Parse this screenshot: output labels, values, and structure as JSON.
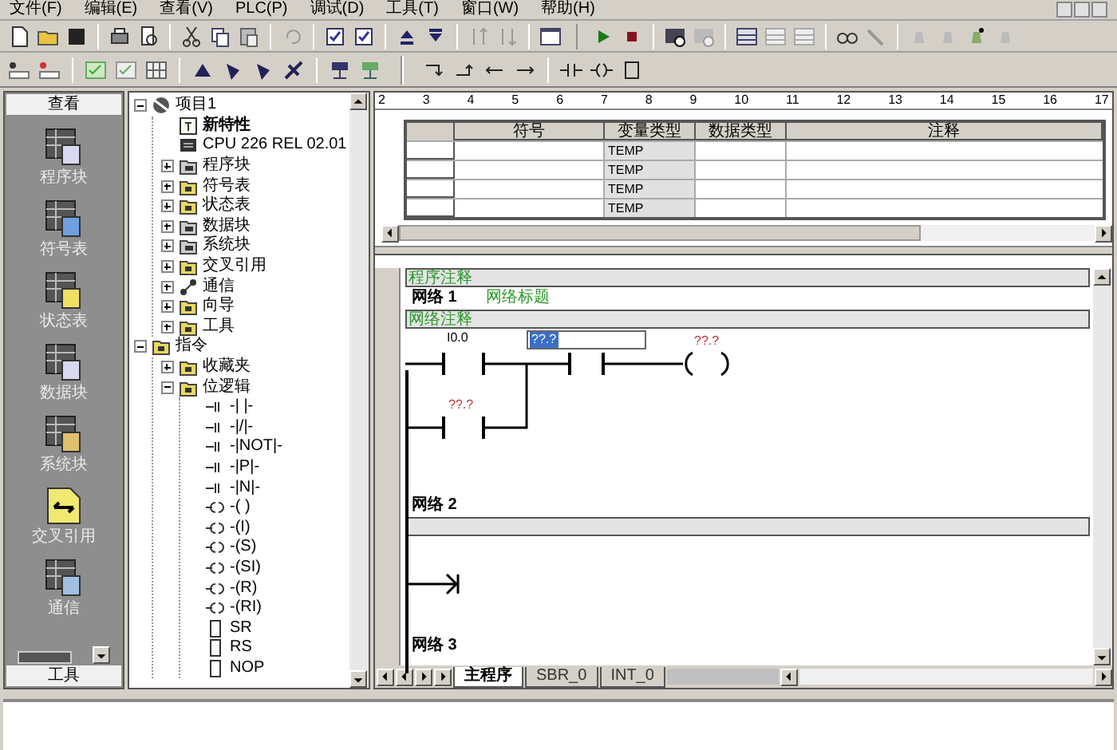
{
  "menu": [
    {
      "label": "文件(F)"
    },
    {
      "label": "编辑(E)"
    },
    {
      "label": "查看(V)"
    },
    {
      "label": "PLC(P)"
    },
    {
      "label": "调试(D)"
    },
    {
      "label": "工具(T)"
    },
    {
      "label": "窗口(W)"
    },
    {
      "label": "帮助(H)"
    }
  ],
  "nav_bar": {
    "header": "查看",
    "items": [
      {
        "label": "程序块"
      },
      {
        "label": "符号表"
      },
      {
        "label": "状态表"
      },
      {
        "label": "数据块"
      },
      {
        "label": "系统块"
      },
      {
        "label": "交叉引用"
      },
      {
        "label": "通信"
      }
    ],
    "footer": "工具"
  },
  "tree": [
    {
      "label": "项目1",
      "kind": "project",
      "expanded": true,
      "children": [
        {
          "label": "新特性",
          "kind": "notes"
        },
        {
          "label": "CPU 226 REL 02.01",
          "kind": "cpu"
        },
        {
          "label": "程序块",
          "kind": "block",
          "expanded": false
        },
        {
          "label": "符号表",
          "kind": "folder",
          "expanded": false
        },
        {
          "label": "状态表",
          "kind": "folder",
          "expanded": false
        },
        {
          "label": "数据块",
          "kind": "block",
          "expanded": false
        },
        {
          "label": "系统块",
          "kind": "block",
          "expanded": false
        },
        {
          "label": "交叉引用",
          "kind": "folder",
          "expanded": false
        },
        {
          "label": "通信",
          "kind": "comms",
          "expanded": false
        },
        {
          "label": "向导",
          "kind": "folder",
          "expanded": false
        },
        {
          "label": "工具",
          "kind": "folder",
          "expanded": false
        }
      ]
    },
    {
      "label": "指令",
      "kind": "folder",
      "expanded": true,
      "children": [
        {
          "label": "收藏夹",
          "kind": "folder",
          "expanded": false
        },
        {
          "label": "位逻辑",
          "kind": "folder",
          "expanded": true,
          "children": [
            {
              "label": "-| |-",
              "kind": "contact"
            },
            {
              "label": "-|/|-",
              "kind": "contact"
            },
            {
              "label": "-|NOT|-",
              "kind": "contact"
            },
            {
              "label": "-|P|-",
              "kind": "contact"
            },
            {
              "label": "-|N|-",
              "kind": "contact"
            },
            {
              "label": "-( )",
              "kind": "coil"
            },
            {
              "label": "-(I)",
              "kind": "coil"
            },
            {
              "label": "-(S)",
              "kind": "coil"
            },
            {
              "label": "-(SI)",
              "kind": "coil"
            },
            {
              "label": "-(R)",
              "kind": "coil"
            },
            {
              "label": "-(RI)",
              "kind": "coil"
            },
            {
              "label": "SR",
              "kind": "box"
            },
            {
              "label": "RS",
              "kind": "box"
            },
            {
              "label": "NOP",
              "kind": "box"
            }
          ]
        }
      ]
    }
  ],
  "ruler": [
    "2",
    "3",
    "4",
    "5",
    "6",
    "7",
    "8",
    "9",
    "10",
    "11",
    "12",
    "13",
    "14",
    "15",
    "16",
    "17"
  ],
  "var_table": {
    "columns": [
      "符号",
      "变量类型",
      "数据类型",
      "注释"
    ],
    "rows": [
      {
        "var_type": "TEMP"
      },
      {
        "var_type": "TEMP"
      },
      {
        "var_type": "TEMP"
      },
      {
        "var_type": "TEMP"
      }
    ]
  },
  "editor": {
    "program_comment": "程序注释",
    "networks": [
      {
        "kind": "ladder",
        "label": "网络 1",
        "title": "网络标题",
        "comment": "网络注释",
        "contact_address": "I0.0",
        "edit_value": "??.?",
        "coil_address": "??.?",
        "parallel_address": "??.?"
      },
      {
        "kind": "empty",
        "label": "网络 2"
      },
      {
        "kind": "heading",
        "label": "网络 3"
      }
    ]
  },
  "tabs": [
    {
      "label": "主程序",
      "selected": true
    },
    {
      "label": "SBR_0",
      "selected": false
    },
    {
      "label": "INT_0",
      "selected": false
    }
  ]
}
